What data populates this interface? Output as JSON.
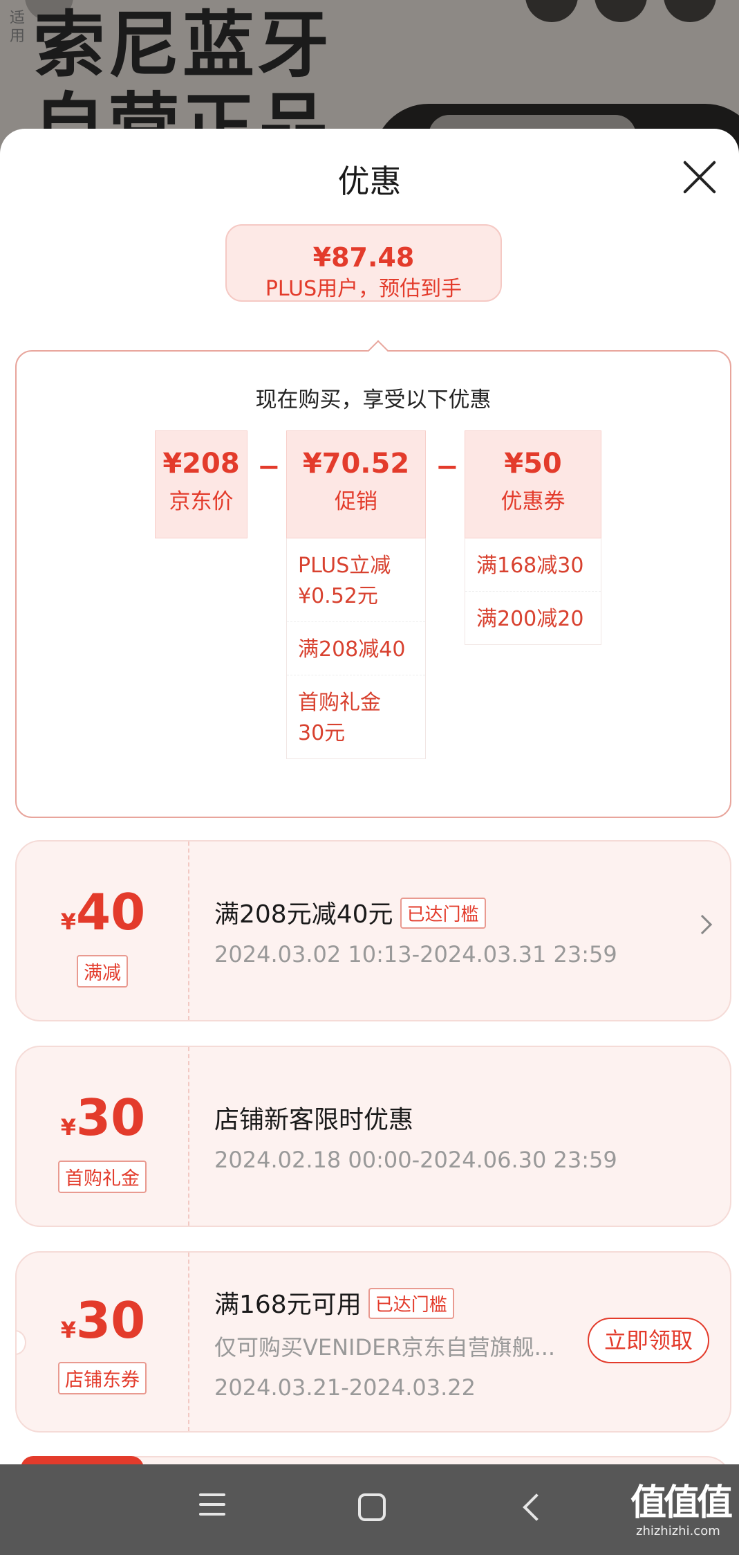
{
  "background": {
    "title": "索尼蓝牙\n自营正品",
    "side_text": "适用"
  },
  "sheet": {
    "title": "优惠"
  },
  "estimate": {
    "price": "¥87.48",
    "label": "PLUS用户，预估到手"
  },
  "calc": {
    "title": "现在购买，享受以下优惠",
    "minus": "−",
    "jd_price": {
      "value": "¥208",
      "label": "京东价"
    },
    "promo": {
      "value": "¥70.52",
      "label": "促销",
      "items": [
        "PLUS立减\n¥0.52元",
        "满208减40",
        "首购礼金\n30元"
      ]
    },
    "coupon": {
      "value": "¥50",
      "label": "优惠券",
      "items": [
        "满168减30",
        "满200减20"
      ]
    }
  },
  "coupons": [
    {
      "currency": "¥",
      "amount": "40",
      "tag": "满减",
      "title": "满208元减40元",
      "badge": "已达门槛",
      "validity": "2024.03.02 10:13-2024.03.31 23:59"
    },
    {
      "currency": "¥",
      "amount": "30",
      "tag": "首购礼金",
      "title": "店铺新客限时优惠",
      "validity": "2024.02.18 00:00-2024.06.30 23:59"
    },
    {
      "currency": "¥",
      "amount": "30",
      "tag": "店铺东券",
      "title": "满168元可用",
      "badge": "已达门槛",
      "desc": "仅可购买VENIDER京东自营旗舰...",
      "validity": "2024.03.21-2024.03.22",
      "button": "立即领取"
    }
  ],
  "watermark": {
    "text": "值值值",
    "url": "zhizhizhi.com"
  },
  "colors": {
    "accent": "#e33b2b",
    "light_bg": "#fde7e4",
    "coupon_bg": "#fdf2f0",
    "nav_bg": "#575757"
  }
}
